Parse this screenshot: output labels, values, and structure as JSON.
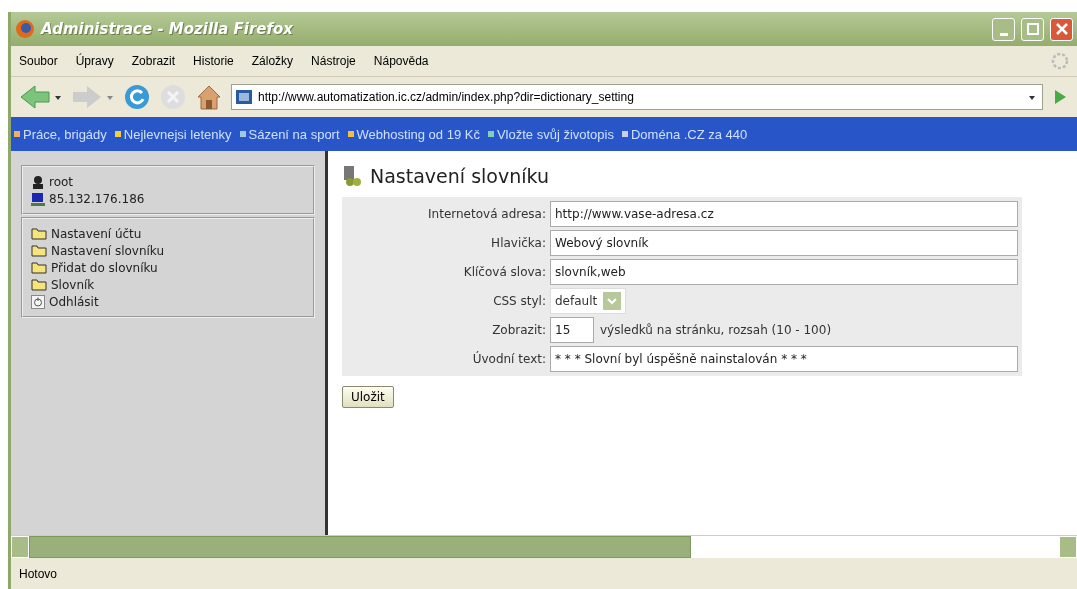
{
  "window": {
    "title": "Administrace - Mozilla Firefox"
  },
  "menu": [
    "Soubor",
    "Úpravy",
    "Zobrazit",
    "Historie",
    "Záložky",
    "Nástroje",
    "Nápověda"
  ],
  "address_bar": {
    "value": "http://www.automatization.ic.cz/admin/index.php?dir=dictionary_setting"
  },
  "bookmarks": [
    {
      "label": "Práce, brigády",
      "color": "#f0b060"
    },
    {
      "label": "Nejlevnejsi letenky",
      "color": "#f0d040"
    },
    {
      "label": "Sázení na sport",
      "color": "#a0c8e0"
    },
    {
      "label": "Webhosting od 19 Kč",
      "color": "#f0c040"
    },
    {
      "label": "Vložte svůj životopis",
      "color": "#80d0c0"
    },
    {
      "label": "Doména .CZ za 440",
      "color": "#c8d0e8"
    }
  ],
  "sidebar": {
    "user": "root",
    "ip": "85.132.176.186",
    "items": [
      {
        "label": "Nastavení účtu",
        "kind": "folder"
      },
      {
        "label": "Nastavení slovníku",
        "kind": "folder"
      },
      {
        "label": "Přidat do slovníku",
        "kind": "folder"
      },
      {
        "label": "Slovník",
        "kind": "folder"
      },
      {
        "label": "Odhlásit",
        "kind": "logout"
      }
    ]
  },
  "page": {
    "heading": "Nastavení slovníku",
    "fields": [
      {
        "label": "Internetová adresa:",
        "kind": "text",
        "value": "http://www.vase-adresa.cz"
      },
      {
        "label": "Hlavička:",
        "kind": "text",
        "value": "Webový slovník"
      },
      {
        "label": "Klíčová slova:",
        "kind": "text",
        "value": "slovník,web"
      },
      {
        "label": "CSS styl:",
        "kind": "select",
        "value": "default"
      },
      {
        "label": "Zobrazit:",
        "kind": "short",
        "value": "15",
        "suffix": "výsledků na stránku, rozsah (10 - 100)"
      },
      {
        "label": "Úvodní text:",
        "kind": "text",
        "value": "* * * Slovní byl úspěšně nainstalován * * *"
      }
    ],
    "save_button": "Uložit"
  },
  "status_bar": {
    "text": "Hotovo"
  }
}
